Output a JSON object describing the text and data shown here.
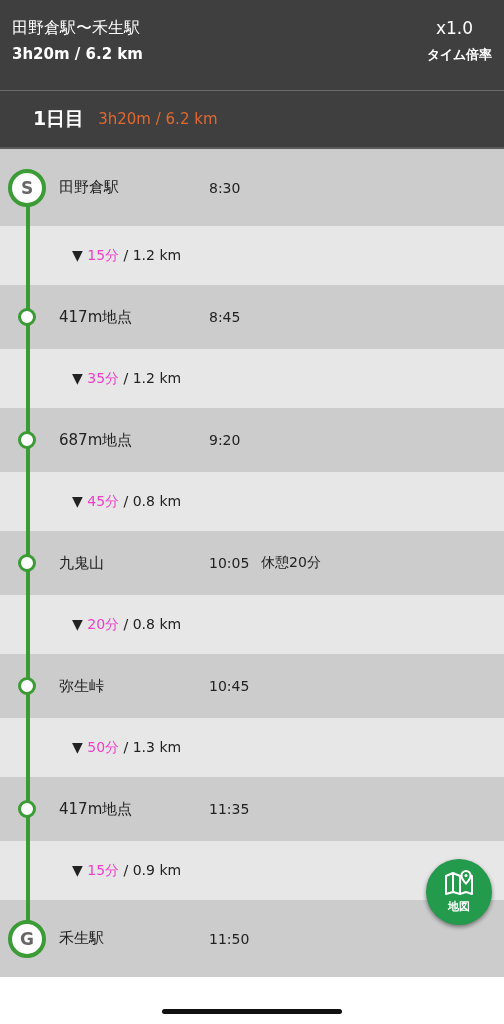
{
  "header": {
    "title": "田野倉駅〜禾生駅",
    "summary": "3h20m / 6.2 km",
    "multiplier": "x1.0",
    "multiplier_label": "タイム倍率"
  },
  "day": {
    "label": "1日目",
    "summary": "3h20m / 6.2 km"
  },
  "timeline": [
    {
      "kind": "start",
      "badge": "S",
      "name": "田野倉駅",
      "time": "8:30"
    },
    {
      "kind": "leg",
      "arrow": "▼",
      "duration": "15分",
      "distance": "/ 1.2 km"
    },
    {
      "kind": "waypoint",
      "name": "417m地点",
      "time": "8:45"
    },
    {
      "kind": "leg",
      "arrow": "▼",
      "duration": "35分",
      "distance": "/ 1.2 km"
    },
    {
      "kind": "waypoint",
      "name": "687m地点",
      "time": "9:20"
    },
    {
      "kind": "leg",
      "arrow": "▼",
      "duration": "45分",
      "distance": "/ 0.8 km"
    },
    {
      "kind": "waypoint",
      "name": "九鬼山",
      "time": "10:05",
      "rest": "休憩20分"
    },
    {
      "kind": "leg",
      "arrow": "▼",
      "duration": "20分",
      "distance": "/ 0.8 km"
    },
    {
      "kind": "waypoint",
      "name": "弥生峠",
      "time": "10:45"
    },
    {
      "kind": "leg",
      "arrow": "▼",
      "duration": "50分",
      "distance": "/ 1.3 km"
    },
    {
      "kind": "waypoint",
      "name": "417m地点",
      "time": "11:35"
    },
    {
      "kind": "leg",
      "arrow": "▼",
      "duration": "15分",
      "distance": "/ 0.9 km"
    },
    {
      "kind": "end",
      "badge": "G",
      "name": "禾生駅",
      "time": "11:50"
    }
  ],
  "map_button": {
    "label": "地図"
  }
}
